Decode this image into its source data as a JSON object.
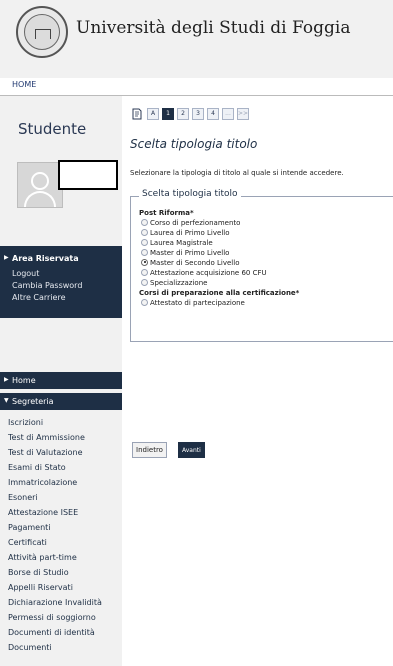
{
  "header": {
    "title": "Università degli Studi di Foggia",
    "nav_home": "HOME"
  },
  "sidebar": {
    "studente": "Studente",
    "area": {
      "title": "Area Riservata",
      "links": [
        "Logout",
        "Cambia Password",
        "Altre Carriere"
      ]
    },
    "nav": {
      "home": "Home",
      "segreteria": "Segreteria"
    },
    "segreteria_items": [
      "Iscrizioni",
      "Test di Ammissione",
      "Test di Valutazione",
      "Esami di Stato",
      "Immatricolazione",
      "Esoneri",
      "Attestazione ISEE",
      "Pagamenti",
      "Certificati",
      "Attività part-time",
      "Borse di Studio",
      "Appelli Riservati",
      "Dichiarazione Invalidità",
      "Permessi di soggiorno",
      "Documenti di identità",
      "Documenti"
    ]
  },
  "main": {
    "steps": [
      "A",
      "1",
      "2",
      "3",
      "4",
      "...",
      ">>"
    ],
    "active_step": "1",
    "title": "Scelta tipologia titolo",
    "instruction": "Selezionare la tipologia di titolo al quale si intende accedere.",
    "fieldset_legend": "Scelta tipologia titolo",
    "group1_label": "Post Riforma*",
    "group1_options": [
      "Corso di perfezionamento",
      "Laurea di Primo Livello",
      "Laurea Magistrale",
      "Master di Primo Livello",
      "Master di Secondo Livello",
      "Attestazione acquisizione 60 CFU",
      "Specializzazione"
    ],
    "selected_option": "Master di Secondo Livello",
    "group2_label": "Corsi di preparazione alla certificazione*",
    "group2_options": [
      "Attestato di partecipazione"
    ],
    "buttons": {
      "back": "Indietro",
      "next": "Avanti"
    }
  }
}
